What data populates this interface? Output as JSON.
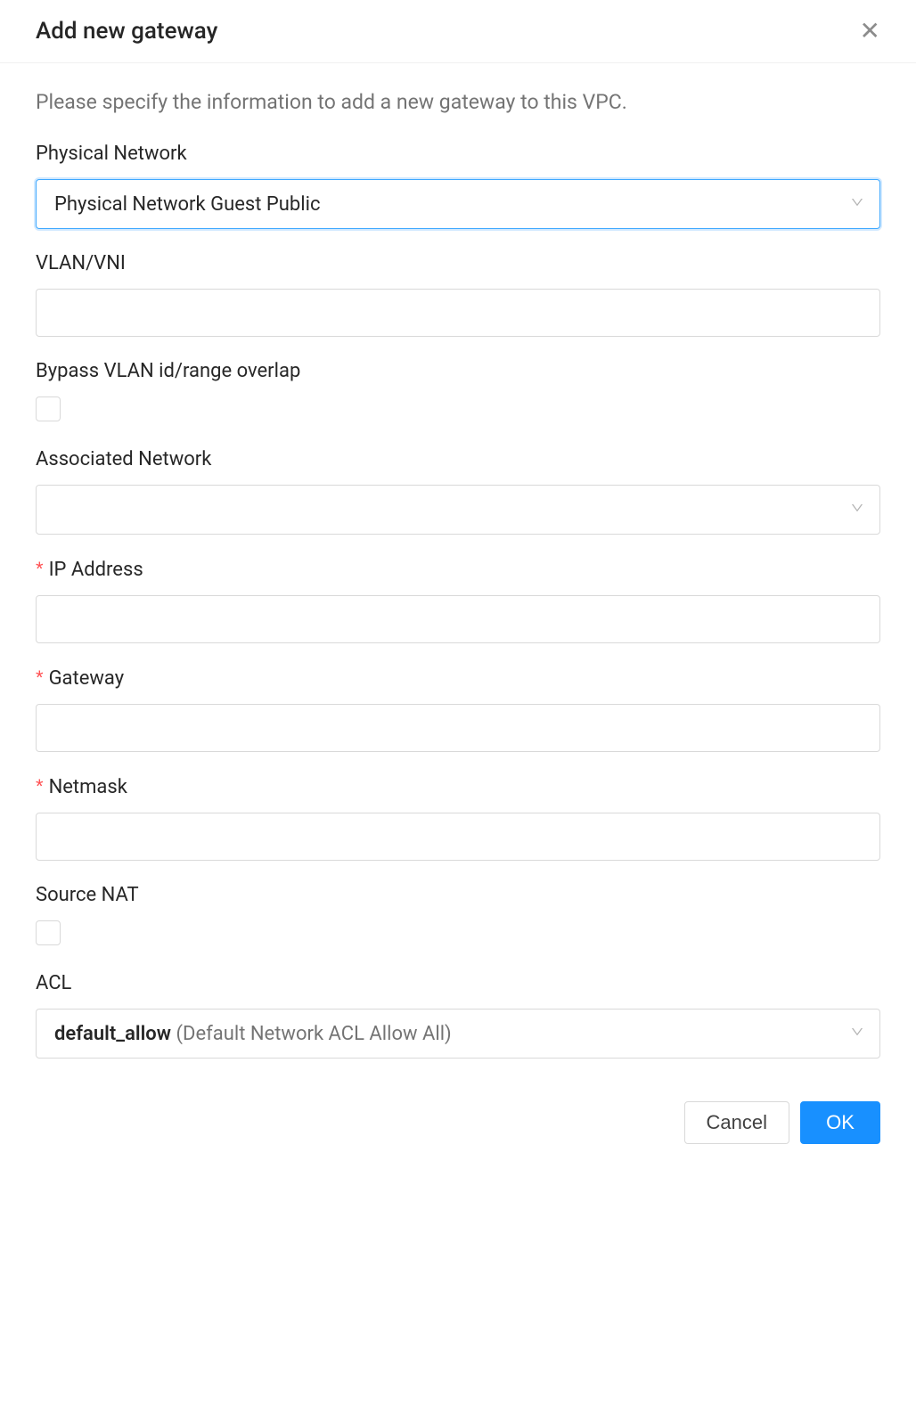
{
  "header": {
    "title": "Add new gateway"
  },
  "description": "Please specify the information to add a new gateway to this VPC.",
  "fields": {
    "physical_network": {
      "label": "Physical Network",
      "value": "Physical Network Guest Public"
    },
    "vlan_vni": {
      "label": "VLAN/VNI",
      "value": ""
    },
    "bypass_vlan": {
      "label": "Bypass VLAN id/range overlap",
      "checked": false
    },
    "associated_network": {
      "label": "Associated Network",
      "value": ""
    },
    "ip_address": {
      "label": "IP Address",
      "required": true,
      "value": ""
    },
    "gateway": {
      "label": "Gateway",
      "required": true,
      "value": ""
    },
    "netmask": {
      "label": "Netmask",
      "required": true,
      "value": ""
    },
    "source_nat": {
      "label": "Source NAT",
      "checked": false
    },
    "acl": {
      "label": "ACL",
      "value_name": "default_allow",
      "value_desc": " (Default Network ACL Allow All)"
    }
  },
  "footer": {
    "cancel": "Cancel",
    "ok": "OK"
  }
}
